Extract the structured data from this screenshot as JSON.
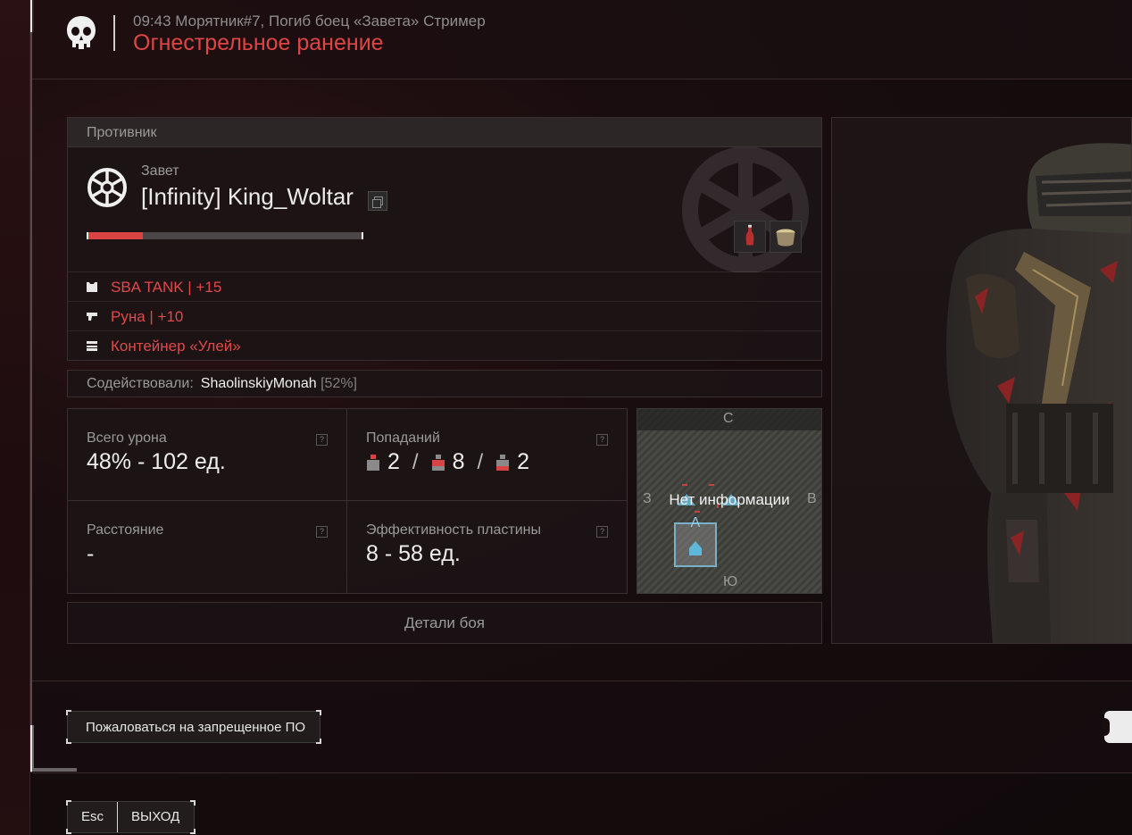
{
  "header": {
    "subtitle": "09:43 Морятник#7, Погиб боец «Завета» Стример",
    "title": "Огнестрельное ранение",
    "icon": "skull-icon"
  },
  "enemy": {
    "section_label": "Противник",
    "faction": "Завет",
    "name": "[Infinity] King_Woltar",
    "health_fraction": 0.2,
    "items": [
      "bottle-icon",
      "pot-icon"
    ]
  },
  "equipment": [
    {
      "icon": "armor-icon",
      "label": "SBA TANK | +15"
    },
    {
      "icon": "pistol-icon",
      "label": "Руна | +10"
    },
    {
      "icon": "container-icon",
      "label": "Контейнер «Улей»"
    }
  ],
  "assist": {
    "label": "Содействовали:",
    "name": "ShaolinskiyMonah",
    "percent": "[52%]"
  },
  "stats": {
    "damage_label": "Всего урона",
    "damage_value": "48% - 102 ед.",
    "hits_label": "Попаданий",
    "hits_head": "2",
    "hits_body": "8",
    "hits_legs": "2",
    "hits_sep": "/",
    "distance_label": "Расстояние",
    "distance_value": "-",
    "plate_label": "Эффективность пластины",
    "plate_value": "8 - 58 ед.",
    "help_glyph": "?"
  },
  "minimap": {
    "north": "С",
    "south": "Ю",
    "west": "З",
    "east": "В",
    "message": "Нет информации",
    "point_label": "A"
  },
  "details_button": "Детали боя",
  "report_button": "Пожаловаться на запрещенное ПО",
  "exit": {
    "key": "Esc",
    "label": "ВЫХОД"
  },
  "colors": {
    "accent_red": "#e04545",
    "text_light": "#eaeaea",
    "text_muted": "#9a9a9a"
  }
}
